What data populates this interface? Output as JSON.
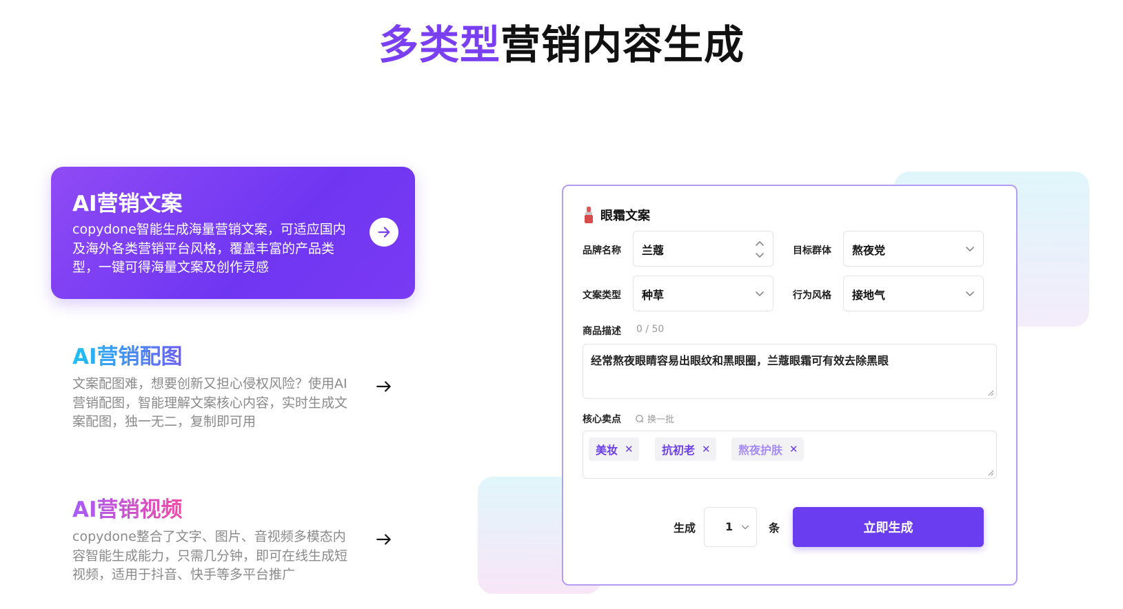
{
  "page": {
    "title_accent": "多类型",
    "title_rest": "营销内容生成"
  },
  "features": [
    {
      "title": "AI营销文案",
      "description": "copydone智能生成海量营销文案，可适应国内及海外各类营销平台风格，覆盖丰富的产品类型，一键可得海量文案及创作灵感",
      "active": true,
      "arrow_icon": "arrow-right-icon"
    },
    {
      "title": "AI营销配图",
      "description": "文案配图难，想要创新又担心侵权风险？使用AI营销配图，智能理解文案核心内容，实时生成文案配图，独一无二，复制即可用",
      "active": false,
      "arrow_icon": "arrow-right-icon"
    },
    {
      "title": "AI营销视频",
      "description": "copydone整合了文字、图片、音视频多模态内容智能生成能力，只需几分钟，即可在线生成短视频，适用于抖音、快手等多平台推广",
      "active": false,
      "arrow_icon": "arrow-right-icon"
    }
  ],
  "form": {
    "title": "眼霜文案",
    "title_icon": "lipstick-icon",
    "brand_label": "品牌名称",
    "brand_value": "兰蔻",
    "audience_label": "目标群体",
    "audience_value": "熬夜党",
    "copy_type_label": "文案类型",
    "copy_type_value": "种草",
    "style_label": "行为风格",
    "style_value": "接地气",
    "desc_label": "商品描述",
    "desc_counter": "0 / 50",
    "desc_value": "经常熬夜眼睛容易出眼纹和黑眼圈，兰蔻眼霜可有效去除黑眼",
    "selling_points_label": "核心卖点",
    "refresh_label": "换一批",
    "tags": [
      "美妆",
      "抗初老",
      "熬夜护肤"
    ],
    "generate_prefix": "生成",
    "count_value": "1",
    "generate_suffix": "条",
    "submit_label": "立即生成"
  },
  "colors": {
    "accent": "#7b3ff2",
    "button": "#6a3ef0",
    "card_border": "#b49bf5"
  }
}
